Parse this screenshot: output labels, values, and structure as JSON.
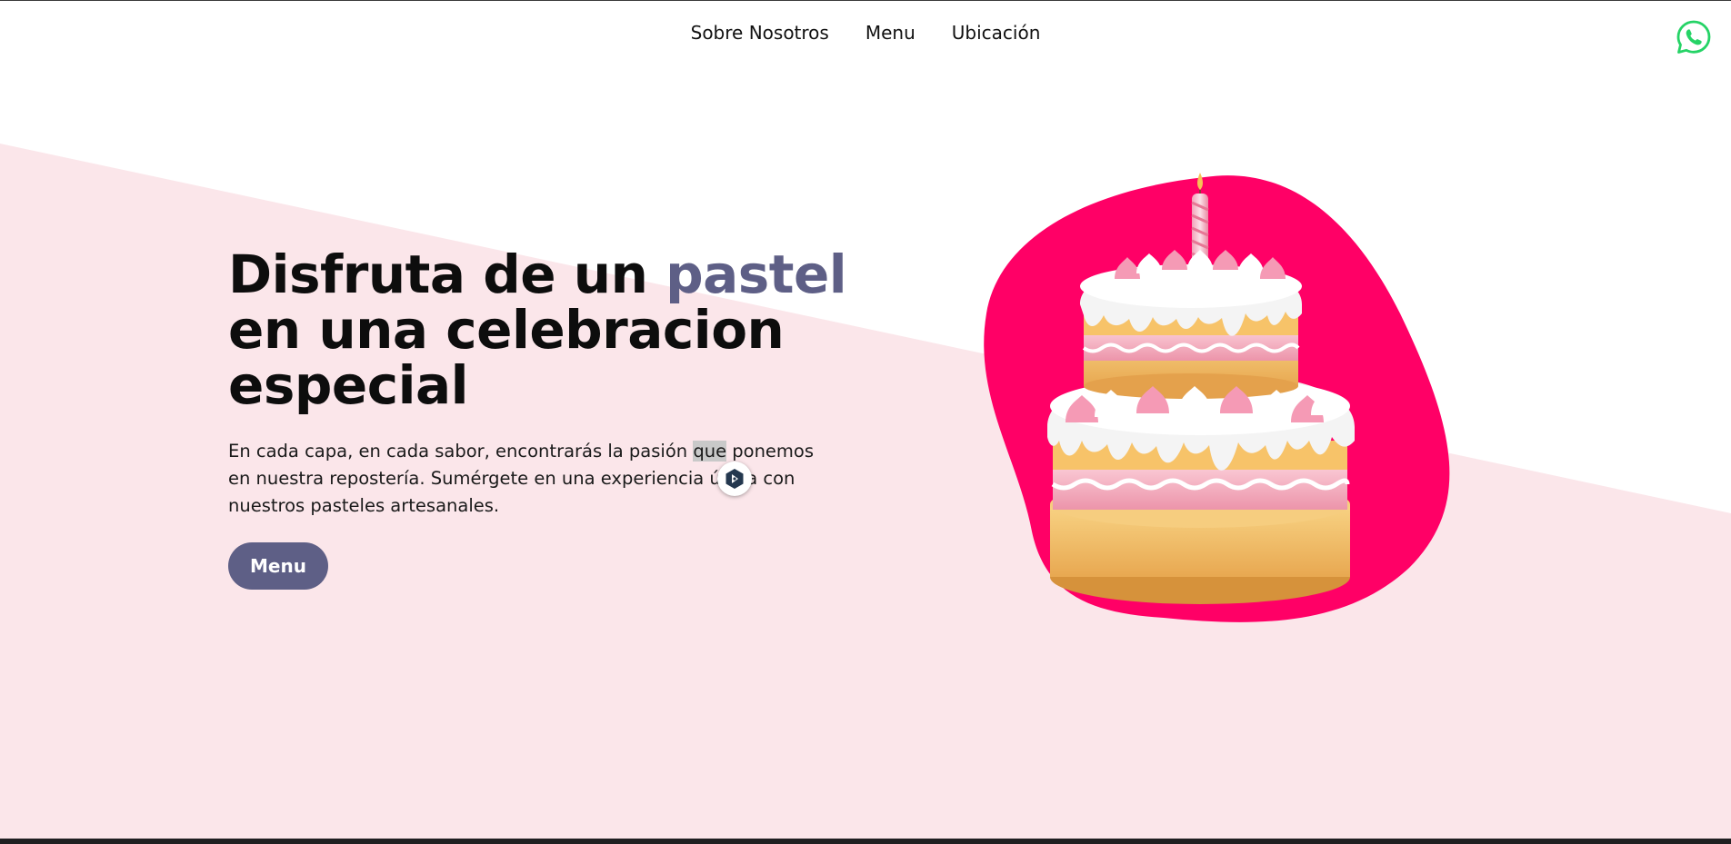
{
  "nav": {
    "items": [
      {
        "label": "Sobre Nosotros"
      },
      {
        "label": "Menu"
      },
      {
        "label": "Ubicación"
      }
    ]
  },
  "hero": {
    "title_part1": "Disfruta de un ",
    "title_accent": "pastel",
    "title_line2": "en una celebracion",
    "title_line3": "especial",
    "text_before_highlight": "En cada capa, en cada sabor, encontrarás la pasión ",
    "text_highlight": "que",
    "text_after_highlight": " ponemos en nuestra repostería. Sumérgete en una experiencia única con nuestros pasteles artesanales.",
    "button_label": "Menu"
  },
  "icons": {
    "whatsapp": "whatsapp-icon",
    "assistant": "assistant-badge-icon",
    "illustration": "birthday-cake-illustration"
  },
  "colors": {
    "accent": "#5e5f86",
    "pink_bg": "#fbe6ea",
    "blob": "#ff0066",
    "whatsapp": "#25d366"
  }
}
